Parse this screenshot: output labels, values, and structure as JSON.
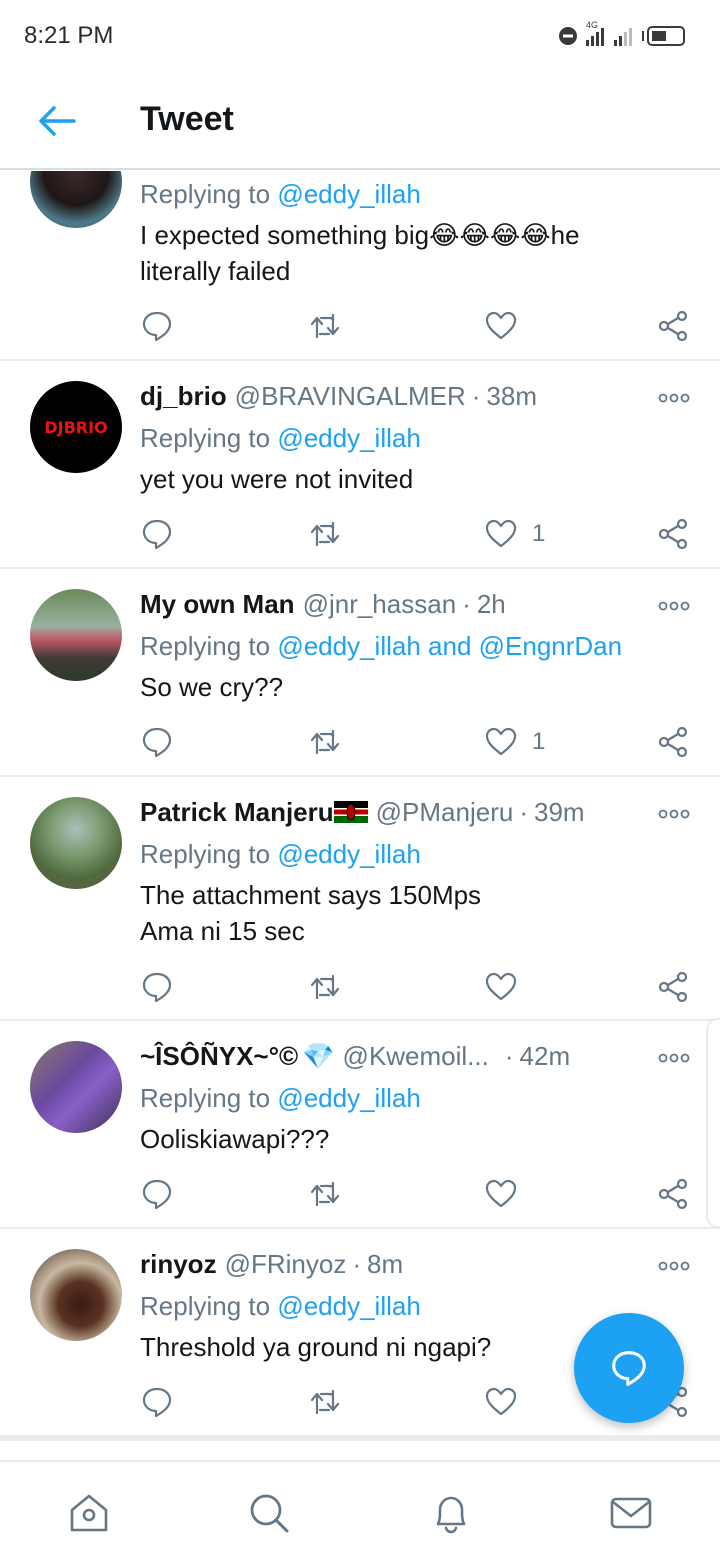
{
  "status_bar": {
    "time": "8:21 PM",
    "network": "4G"
  },
  "header": {
    "title": "Tweet",
    "back_icon": "back-arrow-icon"
  },
  "colors": {
    "accent": "#1da1f2",
    "muted": "#657786",
    "text": "#14171a",
    "divider": "#e6ecf0"
  },
  "tweets": [
    {
      "name": "",
      "handle": "",
      "time": "",
      "replying_prefix": "Replying to",
      "mentions": "@eddy_illah",
      "body_line1_a": "I expected something big",
      "body_emoji": "😂😂😂😂",
      "body_line1_b": "he",
      "body_line2": "literally failed",
      "likes": ""
    },
    {
      "name": "dj_brio",
      "handle": "@BRAVINGALMER",
      "time": "38m",
      "replying_prefix": "Replying to",
      "mentions": "@eddy_illah",
      "body_line1": "yet you were not invited",
      "likes": "1",
      "avatar_text": "DJBRIO"
    },
    {
      "name": "My own Man",
      "handle": "@jnr_hassan",
      "time": "2h",
      "replying_prefix": "Replying to",
      "mentions": "@eddy_illah and @EngnrDan",
      "body_line1": "So we cry??",
      "likes": "1"
    },
    {
      "name": "Patrick Manjeru",
      "handle": "@PManjeru",
      "time": "39m",
      "replying_prefix": "Replying to",
      "mentions": "@eddy_illah",
      "body_line1": "The attachment says 150Mps",
      "body_line2": "Ama ni 15 sec",
      "likes": ""
    },
    {
      "name": "~ÎSÔÑYX~°©",
      "handle": "@Kwemoil...",
      "time": "42m",
      "name_emoji": "💎",
      "replying_prefix": "Replying to",
      "mentions": "@eddy_illah",
      "body_line1": "Ooliskiawapi???",
      "likes": ""
    },
    {
      "name": "rinyoz",
      "handle": "@FRinyoz",
      "time": "8m",
      "replying_prefix": "Replying to",
      "mentions": "@eddy_illah",
      "body_line1": "Threshold ya ground ni ngapi?",
      "likes": ""
    }
  ],
  "action_icons": [
    "reply-icon",
    "retweet-icon",
    "like-icon",
    "share-icon"
  ],
  "fab": {
    "icon": "compose-reply-icon"
  },
  "bottom_nav": [
    "home-icon",
    "search-icon",
    "notifications-icon",
    "messages-icon"
  ]
}
